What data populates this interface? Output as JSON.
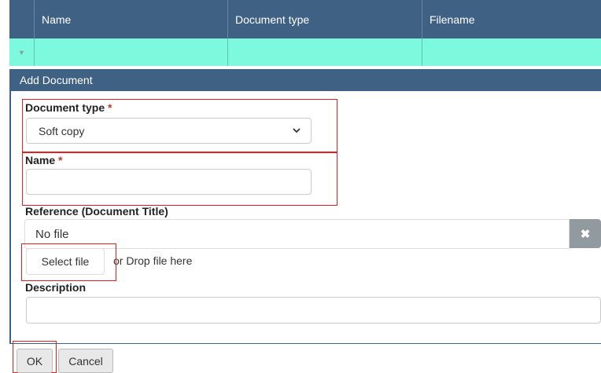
{
  "grid": {
    "columns": [
      "Name",
      "Document type",
      "Filename"
    ],
    "expand_icon": "caret-down-icon"
  },
  "dialog": {
    "title": "Add Document",
    "document_type": {
      "label": "Document type",
      "required_mark": "*",
      "selected": "Soft copy"
    },
    "name": {
      "label": "Name",
      "required_mark": "*",
      "value": ""
    },
    "reference": {
      "label": "Reference (Document Title)",
      "file_status": "No file",
      "clear_icon": "close-icon",
      "clear_symbol": "✖",
      "select_file_label": "Select file",
      "drop_hint": "or Drop file here"
    },
    "description": {
      "label": "Description",
      "value": ""
    }
  },
  "buttons": {
    "ok": "OK",
    "cancel": "Cancel"
  },
  "colors": {
    "header": "#3f6184",
    "row_highlight": "#7dfadd",
    "required": "#c0392b",
    "annotation_border": "#e02020"
  }
}
